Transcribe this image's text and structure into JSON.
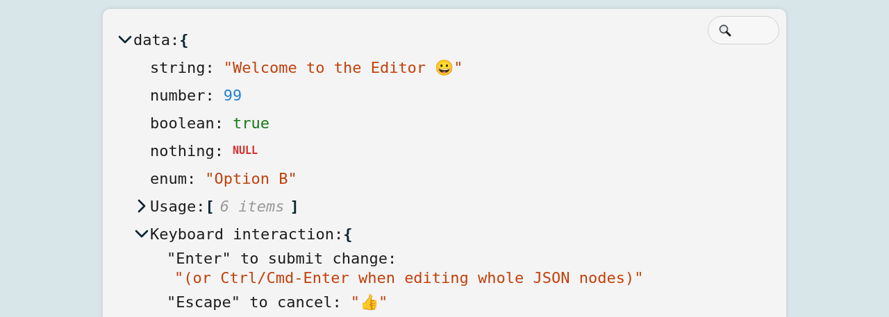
{
  "tree": {
    "key": "data:",
    "kind": "object",
    "open_bracket": "{",
    "expanded": true,
    "children": [
      {
        "key": "string:",
        "kind": "string",
        "value": "\"Welcome to the Editor 😀\""
      },
      {
        "key": "number:",
        "kind": "number",
        "value": "99"
      },
      {
        "key": "boolean:",
        "kind": "boolean",
        "value": "true"
      },
      {
        "key": "nothing:",
        "kind": "null",
        "value": "NULL"
      },
      {
        "key": "enum:",
        "kind": "string",
        "value": "\"Option B\""
      },
      {
        "key": "Usage:",
        "kind": "array",
        "open_bracket": "[",
        "count": "6 items",
        "close_bracket": "]",
        "expanded": false
      },
      {
        "key": "Keyboard interaction:",
        "kind": "object",
        "open_bracket": "{",
        "expanded": true,
        "children": [
          {
            "key": "\"Enter\" to submit change:",
            "kind": "string",
            "value": "\"(or Ctrl/Cmd-Enter when editing whole JSON nodes)\"",
            "wrapped": true
          },
          {
            "key": "\"Escape\" to cancel:",
            "kind": "string",
            "value": "\"👍\""
          }
        ]
      }
    ]
  }
}
